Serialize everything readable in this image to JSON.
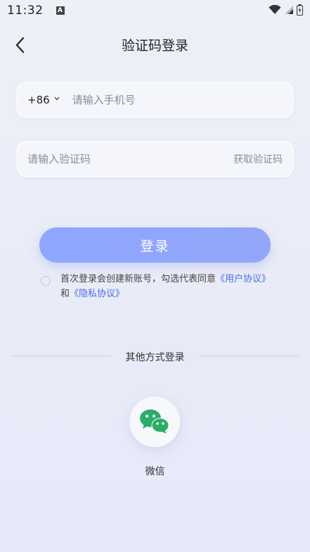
{
  "status_bar": {
    "time": "11:32",
    "badge": "A",
    "icons": [
      "wifi-icon",
      "signal-icon",
      "battery-icon"
    ]
  },
  "nav": {
    "title": "验证码登录",
    "back_icon": "chevron-left-icon"
  },
  "phone_field": {
    "country_code": "+86",
    "dropdown_icon": "chevron-down-icon",
    "placeholder": "请输入手机号",
    "value": ""
  },
  "code_field": {
    "placeholder": "请输入验证码",
    "value": "",
    "get_code_label": "获取验证码"
  },
  "login_button": {
    "label": "登录"
  },
  "agreement": {
    "checked": false,
    "text_before": "首次登录会创建新账号，勾选代表同意",
    "user_agreement": "《用户协议》",
    "conjunction": "和",
    "privacy_policy": "《隐私协议》"
  },
  "other_login": {
    "divider_text": "其他方式登录",
    "wechat_label": "微信",
    "wechat_icon": "wechat-icon"
  },
  "colors": {
    "primary_button": "#8ea7ff",
    "link": "#4a6cf0",
    "wechat_green": "#2aae67",
    "background": "#eceef8"
  }
}
